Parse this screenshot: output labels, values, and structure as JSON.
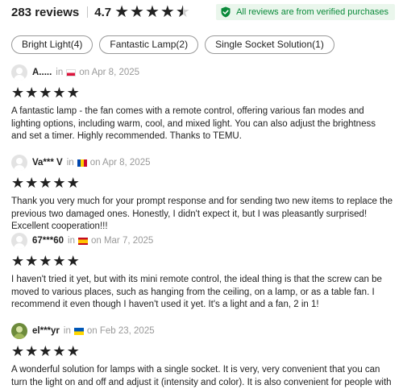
{
  "header": {
    "review_count": "283 reviews",
    "rating": "4.7",
    "stars_filled": 4.5,
    "verified_text": "All reviews are from verified purchases"
  },
  "tags": [
    {
      "label": "Bright Light(4)"
    },
    {
      "label": "Fantastic Lamp(2)"
    },
    {
      "label": "Single Socket Solution(1)"
    }
  ],
  "reviews": [
    {
      "user": "A.....",
      "in": "in",
      "flag": "poland",
      "date": "on Apr 8, 2025",
      "stars": 5,
      "text": "A fantastic lamp - the fan comes with a remote control, offering various fan modes and lighting options, including warm, cool, and mixed light. You can also adjust the brightness and set a timer. Highly recommended. Thanks to TEMU."
    },
    {
      "user": "Va*** V",
      "in": "in",
      "flag": "moldova",
      "date": "on Apr 8, 2025",
      "stars": 5,
      "text": "Thank you very much for your prompt response and for sending two new items to replace the previous two damaged ones. Honestly, I didn't expect it, but I was pleasantly surprised! Excellent cooperation!!!"
    },
    {
      "user": "67***60",
      "in": "in",
      "flag": "spain",
      "date": "on Mar 7, 2025",
      "stars": 5,
      "text": "I haven't tried it yet, but with its mini remote control, the ideal thing is that the screw can be moved to various places, such as hanging from the ceiling, on a lamp, or as a table fan. I recommend it even though I haven't used it yet. It's a light and a fan, 2 in 1!"
    },
    {
      "user": "el***yr",
      "in": "in",
      "flag": "ukraine",
      "date": "on Feb 23, 2025",
      "stars": 5,
      "text": "A wonderful solution for lamps with a single socket. It is very, very convenient that you can turn the light on and off and adjust it (intensity and color). It is also convenient for people with limited mobility."
    }
  ],
  "colors": {
    "verified_bg": "#eaf6ec",
    "verified_text": "#0a8a3a",
    "star": "#222222",
    "muted": "#999999"
  }
}
